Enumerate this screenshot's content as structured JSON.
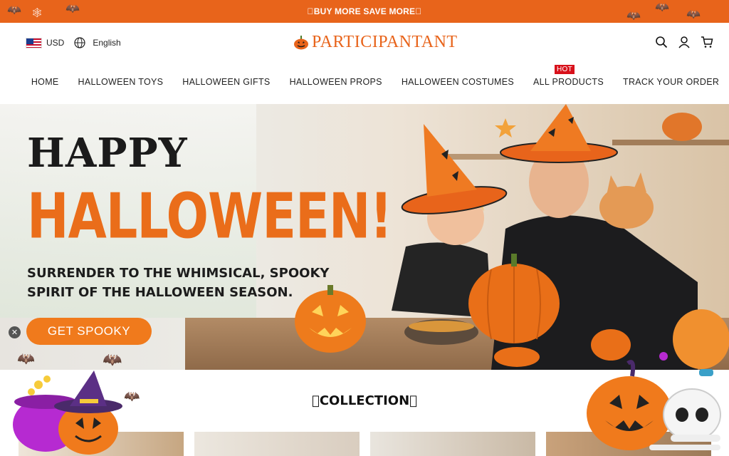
{
  "announcement": {
    "text": "\u0000BUY MORE SAVE MORE\u0000",
    "bg": "#e8641b"
  },
  "header": {
    "currency": "USD",
    "language": "English",
    "logo_text": "PARTICIPANTANT",
    "icons": [
      "search-icon",
      "account-icon",
      "cart-icon"
    ]
  },
  "nav": {
    "items": [
      {
        "label": "HOME"
      },
      {
        "label": "HALLOWEEN TOYS"
      },
      {
        "label": "HALLOWEEN GIFTS"
      },
      {
        "label": "HALLOWEEN PROPS"
      },
      {
        "label": "HALLOWEEN COSTUMES"
      },
      {
        "label": "ALL PRODUCTS",
        "badge": "HOT"
      },
      {
        "label": "TRACK YOUR ORDER"
      }
    ]
  },
  "hero": {
    "title_line1": "HAPPY",
    "title_line2": "HALLOWEEN!",
    "subtitle_line1": "SURRENDER TO THE WHIMSICAL, SPOOKY",
    "subtitle_line2": "SPIRIT OF THE HALLOWEEN SEASON.",
    "cta_label": "GET SPOOKY",
    "close_glyph": "✕"
  },
  "collection": {
    "title": "\u0000COLLECTION\u0000"
  },
  "colors": {
    "brand_orange": "#e8641b",
    "cta_orange": "#f07a1c",
    "hot_red": "#d8111b",
    "title_orange": "#ea6d1a"
  }
}
